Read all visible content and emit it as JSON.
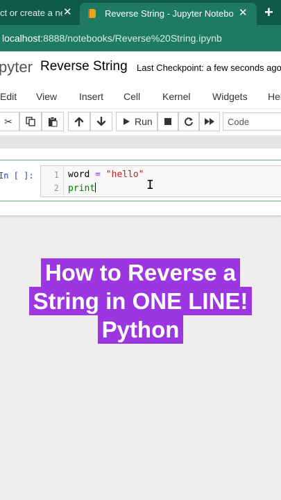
{
  "browser": {
    "tabs": [
      {
        "label": "ct or create a new",
        "active": false
      },
      {
        "label": "Reverse String - Jupyter Notebook",
        "active": true
      }
    ],
    "close_glyph": "✕",
    "new_tab_glyph": "+",
    "url_host": "localhost",
    "url_path": ":8888/notebooks/Reverse%20String.ipynb"
  },
  "jupyter": {
    "logo_text": "pyter",
    "notebook_title": "Reverse String",
    "checkpoint": "Last Checkpoint: a few seconds ago"
  },
  "menu": [
    "Edit",
    "View",
    "Insert",
    "Cell",
    "Kernel",
    "Widgets",
    "Help"
  ],
  "toolbar": {
    "run_label": "Run",
    "cell_type": "Code",
    "icons": [
      "cut-icon",
      "copy-icon",
      "paste-icon",
      "arrow-up-icon",
      "arrow-down-icon",
      "play-icon",
      "stop-icon",
      "restart-icon",
      "fast-forward-icon"
    ]
  },
  "cell": {
    "prompt": "In [ ]:",
    "lines": [
      {
        "number": "1",
        "var": "word",
        "op": " = ",
        "string": "\"hello\""
      },
      {
        "number": "2",
        "builtin": "print"
      }
    ]
  },
  "caption": {
    "lines": [
      "How to Reverse a",
      "String in ONE LINE!",
      "Python"
    ]
  },
  "colors": {
    "tab_strip": "#0f5a4a",
    "address_bar": "#1f7a63",
    "caption_bg": "#9b36e0",
    "cell_border": "#66bb6a"
  }
}
